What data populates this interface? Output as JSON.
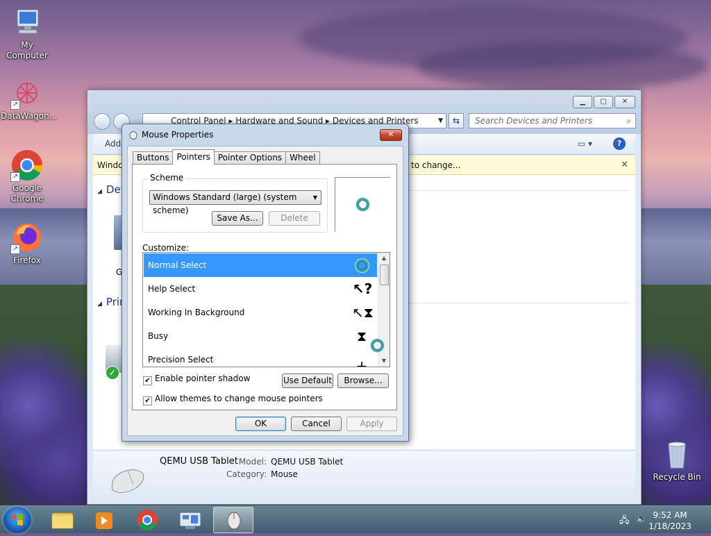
{
  "desktop": {
    "icons": [
      {
        "label": "My Computer",
        "icon": "computer-icon"
      },
      {
        "label": "DataWagon...",
        "icon": "datawagon-icon"
      },
      {
        "label": "Google Chrome",
        "icon": "chrome-icon"
      },
      {
        "label": "Firefox",
        "icon": "firefox-icon"
      },
      {
        "label": "Recycle Bin",
        "icon": "recycle-bin-icon"
      }
    ]
  },
  "explorer": {
    "breadcrumb": [
      "Control Panel",
      "Hardware and Sound",
      "Devices and Printers"
    ],
    "search_placeholder": "Search Devices and Printers",
    "cmd_add": "Add",
    "infobar_left": "Windo",
    "infobar_right": "to change...",
    "groups": [
      "Dev",
      "Prin"
    ],
    "device_partial_label": "G",
    "details": {
      "name": "QEMU USB Tablet",
      "model_label": "Model:",
      "model_value": "QEMU USB Tablet",
      "category_label": "Category:",
      "category_value": "Mouse"
    }
  },
  "dialog": {
    "title": "Mouse Properties",
    "close_glyph": "✕",
    "tabs": [
      "Buttons",
      "Pointers",
      "Pointer Options",
      "Wheel"
    ],
    "active_tab": "Pointers",
    "scheme_legend": "Scheme",
    "scheme_value": "Windows Standard (large) (system scheme)",
    "save_as": "Save As...",
    "delete": "Delete",
    "customize_label": "Customize:",
    "pointer_rows": [
      {
        "label": "Normal Select",
        "cursor": "busy-ring"
      },
      {
        "label": "Help Select",
        "cursor": "help"
      },
      {
        "label": "Working In Background",
        "cursor": "working"
      },
      {
        "label": "Busy",
        "cursor": "hourglass"
      },
      {
        "label": "Precision Select",
        "cursor": "crosshair"
      }
    ],
    "selected_row": "Normal Select",
    "enable_shadow": "Enable pointer shadow",
    "enable_shadow_checked": true,
    "allow_themes": "Allow themes to change mouse pointers",
    "allow_themes_checked": true,
    "use_default": "Use Default",
    "browse": "Browse...",
    "ok": "OK",
    "cancel": "Cancel",
    "apply": "Apply"
  },
  "taskbar": {
    "time": "9:52 AM",
    "date": "1/18/2023"
  },
  "colors": {
    "selection": "#3399ff",
    "title_close": "#c7452e",
    "infobar": "#fefcd8"
  }
}
